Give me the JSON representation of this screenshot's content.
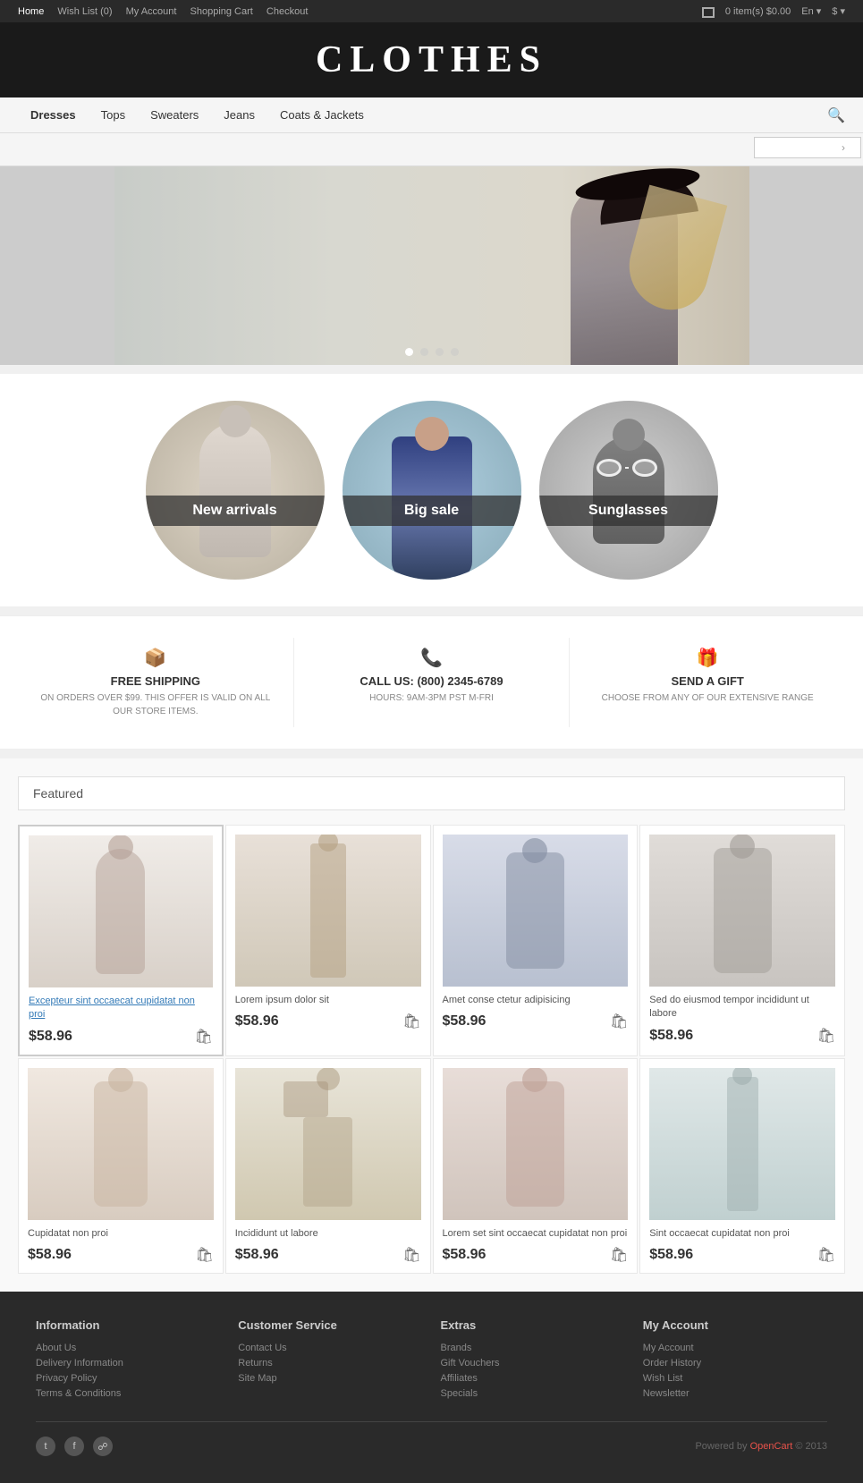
{
  "topbar": {
    "links": [
      "Home",
      "Wish List (0)",
      "My Account",
      "Shopping Cart",
      "Checkout"
    ],
    "active_link": "Home",
    "cart_label": "0 item(s) $0.00",
    "lang_label": "En",
    "currency_label": "$"
  },
  "header": {
    "title": "CLOTHES"
  },
  "nav": {
    "links": [
      "Dresses",
      "Tops",
      "Sweaters",
      "Jeans",
      "Coats & Jackets"
    ],
    "search_placeholder": ""
  },
  "hero": {
    "dots": [
      true,
      false,
      false,
      false
    ]
  },
  "categories": [
    {
      "label": "New arrivals",
      "bg": "circle-bg-1"
    },
    {
      "label": "Big sale",
      "bg": "circle-bg-2"
    },
    {
      "label": "Sunglasses",
      "bg": "circle-bg-3"
    }
  ],
  "info_strip": [
    {
      "title": "FREE SHIPPING",
      "desc": "ON ORDERS OVER $99. THIS OFFER IS VALID ON ALL OUR STORE ITEMS."
    },
    {
      "title": "CALL US: (800) 2345-6789",
      "desc": "HOURS: 9AM-3PM PST M-FRI"
    },
    {
      "title": "SEND A GIFT",
      "desc": "CHOOSE FROM ANY OF OUR EXTENSIVE RANGE"
    }
  ],
  "featured": {
    "section_title": "Featured",
    "products": [
      {
        "name_link": "Excepteur sint occaecat cupidatat non proi",
        "name_plain": "",
        "price": "$58.96",
        "img_class": "product-img-1"
      },
      {
        "name_link": "",
        "name_plain": "Lorem ipsum dolor sit",
        "price": "$58.96",
        "img_class": "product-img-2"
      },
      {
        "name_link": "",
        "name_plain": "Amet conse ctetur adipisicing",
        "price": "$58.96",
        "img_class": "product-img-3"
      },
      {
        "name_link": "",
        "name_plain": "Sed do eiusmod tempor incididunt ut labore",
        "price": "$58.96",
        "img_class": "product-img-4"
      },
      {
        "name_link": "",
        "name_plain": "Cupidatat non proi",
        "price": "$58.96",
        "img_class": "product-img-5"
      },
      {
        "name_link": "",
        "name_plain": "Incididunt ut labore",
        "price": "$58.96",
        "img_class": "product-img-6"
      },
      {
        "name_link": "",
        "name_plain": "Lorem set sint occaecat cupidatat non proi",
        "price": "$58.96",
        "img_class": "product-img-7"
      },
      {
        "name_link": "",
        "name_plain": "Sint occaecat cupidatat non proi",
        "price": "$58.96",
        "img_class": "product-img-8"
      }
    ]
  },
  "footer": {
    "columns": [
      {
        "title": "Information",
        "links": [
          "About Us",
          "Delivery Information",
          "Privacy Policy",
          "Terms & Conditions"
        ]
      },
      {
        "title": "Customer Service",
        "links": [
          "Contact Us",
          "Returns",
          "Site Map"
        ]
      },
      {
        "title": "Extras",
        "links": [
          "Brands",
          "Gift Vouchers",
          "Affiliates",
          "Specials"
        ]
      },
      {
        "title": "My Account",
        "links": [
          "My Account",
          "Order History",
          "Wish List",
          "Newsletter"
        ]
      }
    ],
    "social": [
      "t",
      "f",
      "rss"
    ],
    "powered_label": "Powered by",
    "powered_brand": "OpenCart",
    "powered_year": "© 2013"
  }
}
